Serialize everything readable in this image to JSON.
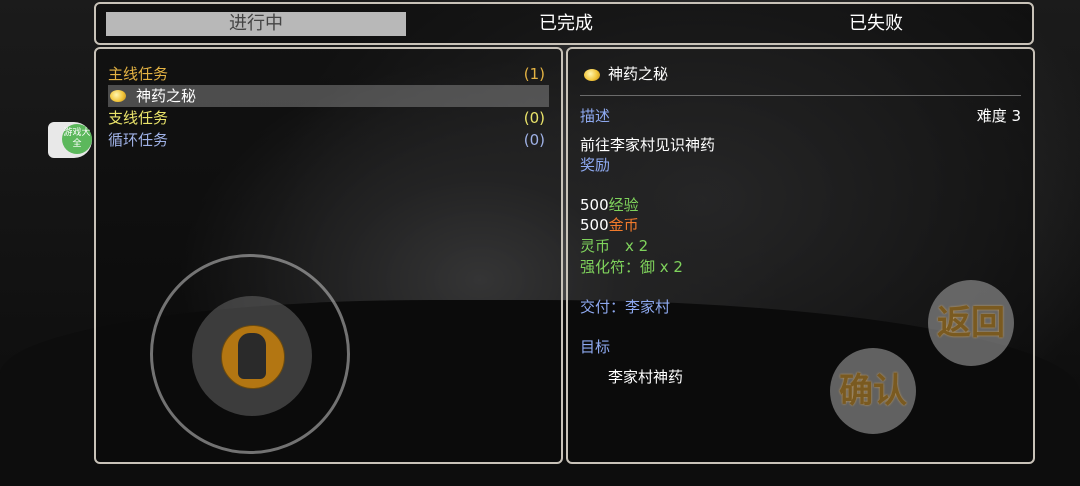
{
  "tabs": [
    {
      "label": "进行中",
      "active": true
    },
    {
      "label": "已完成",
      "active": false
    },
    {
      "label": "已失败",
      "active": false
    }
  ],
  "badge": {
    "text": "游戏大全"
  },
  "quest_list": {
    "main": {
      "label": "主线任务",
      "count": "(1)"
    },
    "main_item": {
      "label": "神药之秘"
    },
    "side": {
      "label": "支线任务",
      "count": "(0)"
    },
    "loop": {
      "label": "循环任务",
      "count": "(0)"
    }
  },
  "detail": {
    "title": "神药之秘",
    "desc_label": "描述",
    "difficulty": "难度 3",
    "desc_text": "前往李家村见识神药",
    "reward_label": "奖励",
    "rewards": {
      "exp_amount": "500",
      "exp_label": "经验",
      "gold_amount": "500",
      "gold_label": "金币",
      "lingbi": "灵币　x 2",
      "qianghua": "强化符：御 x 2"
    },
    "deliver": "交付：李家村",
    "goal_label": "目标",
    "goal_text": "李家村神药"
  },
  "buttons": {
    "back": "返回",
    "confirm": "确认"
  },
  "colors": {
    "accent_gold": "#e3b243",
    "count_yellow": "#e9e36a",
    "label_blue": "#8ea9f0",
    "reward_green": "#7fd35c",
    "gold_orange": "#f07a2c",
    "frame": "#c8c2b8"
  }
}
